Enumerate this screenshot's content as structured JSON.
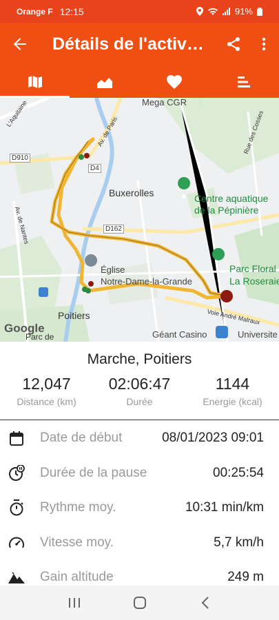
{
  "status_bar": {
    "carrier": "Orange F",
    "time": "12:15",
    "battery": "91%"
  },
  "app_bar": {
    "title": "Détails de l'activ…"
  },
  "map": {
    "labels": {
      "mega": "Mega CGR",
      "buxerolles": "Buxerolles",
      "centre1": "Centre aquatique",
      "centre2": "de la Pépinière",
      "parc1": "Parc Floral",
      "parc2": "La Roseraie",
      "eglise1": "Église",
      "eglise2": "Notre-Dame-la-Grande",
      "poitiers": "Poitiers",
      "geant": "Géant Casino",
      "universite": "Universite",
      "parcde": "Parc de",
      "google": "Google",
      "aquitaine": "L'Aquitaine",
      "nantes": "Av. de Nantes",
      "paris": "Av. de Paris",
      "cosses": "Rue des Cosses",
      "malraux": "Voie André Malraux"
    },
    "roads": {
      "d910": "D910",
      "d4": "D4",
      "d162": "D162"
    }
  },
  "summary": {
    "activity_name": "Marche, Poitiers",
    "stats": [
      {
        "value": "12,047",
        "label": "Distance (km)"
      },
      {
        "value": "02:06:47",
        "label": "Durée"
      },
      {
        "value": "1144",
        "label": "Energie (kcal)"
      }
    ]
  },
  "details": [
    {
      "icon": "calendar-icon",
      "label": "Date de début",
      "value": "08/01/2023 09:01"
    },
    {
      "icon": "pause-timer-icon",
      "label": "Durée de la pause",
      "value": "00:25:54"
    },
    {
      "icon": "stopwatch-icon",
      "label": "Rythme moy.",
      "value": "10:31 min/km"
    },
    {
      "icon": "speedometer-icon",
      "label": "Vitesse moy.",
      "value": "5,7 km/h"
    },
    {
      "icon": "mountain-icon",
      "label": "Gain altitude",
      "value": "249 m"
    }
  ],
  "colors": {
    "accent": "#f04f13",
    "status": "#e9431b",
    "route": "#f2b531"
  }
}
